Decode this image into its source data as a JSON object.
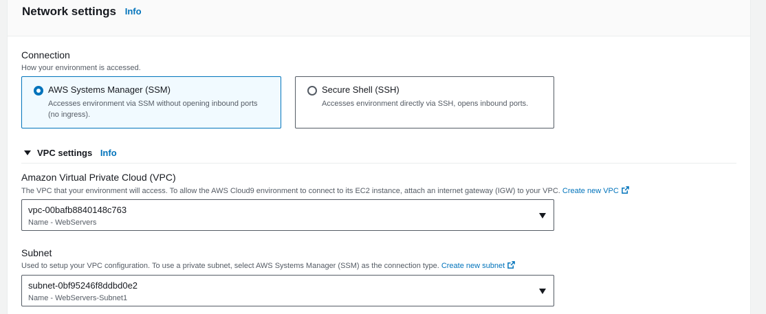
{
  "section": {
    "title": "Network settings",
    "info": "Info"
  },
  "connection": {
    "label": "Connection",
    "description": "How your environment is accessed.",
    "options": [
      {
        "label": "AWS Systems Manager (SSM)",
        "description": "Accesses environment via SSM without opening inbound ports (no ingress).",
        "selected": true
      },
      {
        "label": "Secure Shell (SSH)",
        "description": "Accesses environment directly via SSH, opens inbound ports.",
        "selected": false
      }
    ]
  },
  "vpc_settings": {
    "label": "VPC settings",
    "info": "Info",
    "expanded": true
  },
  "vpc": {
    "label": "Amazon Virtual Private Cloud (VPC)",
    "description": "The VPC that your environment will access. To allow the AWS Cloud9 environment to connect to its EC2 instance, attach an internet gateway (IGW) to your VPC.",
    "create_link": "Create new VPC",
    "selected_value": "vpc-00bafb8840148c763",
    "selected_sub": "Name - WebServers"
  },
  "subnet": {
    "label": "Subnet",
    "description": "Used to setup your VPC configuration. To use a private subnet, select AWS Systems Manager (SSM) as the connection type.",
    "create_link": "Create new subnet",
    "selected_value": "subnet-0bf95246f8ddbd0e2",
    "selected_sub": "Name - WebServers-Subnet1"
  },
  "colors": {
    "accent": "#0073bb",
    "selected_tile_bg": "#f1faff",
    "text": "#16191f",
    "muted": "#545b64"
  }
}
